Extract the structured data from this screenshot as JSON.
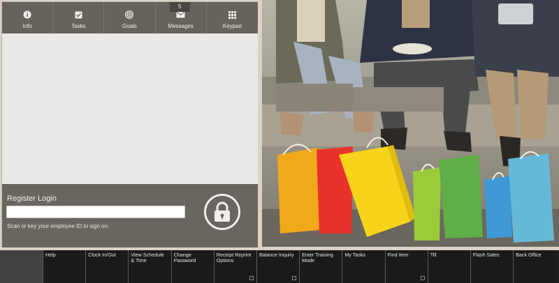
{
  "tabs": [
    {
      "label": "Info",
      "icon": "info-icon",
      "active": true
    },
    {
      "label": "Tasks",
      "icon": "tasks-icon"
    },
    {
      "label": "Goals",
      "icon": "goals-icon"
    },
    {
      "label": "Messages",
      "icon": "envelope-icon",
      "badge": "5"
    },
    {
      "label": "Keypad",
      "icon": "keypad-icon"
    }
  ],
  "register": {
    "title": "Register Login",
    "hint": "Scan or key your employee ID to sign on.",
    "input_value": ""
  },
  "toolbar": [
    {
      "label": "Help"
    },
    {
      "label": "Clock In/Out"
    },
    {
      "label": "View Schedule & Time"
    },
    {
      "label": "Change Password"
    },
    {
      "label": "Receipt Reprint Options",
      "corner": true
    },
    {
      "label": "Balance Inquiry",
      "corner": true
    },
    {
      "label": "Enter Training Mode"
    },
    {
      "label": "My Tasks"
    },
    {
      "label": "Find Item",
      "corner": true
    },
    {
      "label": "Till"
    },
    {
      "label": "Flash Sales"
    },
    {
      "label": "Back Office"
    }
  ],
  "colors": {
    "tab_bar": "#67625c",
    "panel_bg": "#e9e8e6",
    "register_bg": "#6a655f",
    "toolbar_bg": "#1a1a1a"
  }
}
